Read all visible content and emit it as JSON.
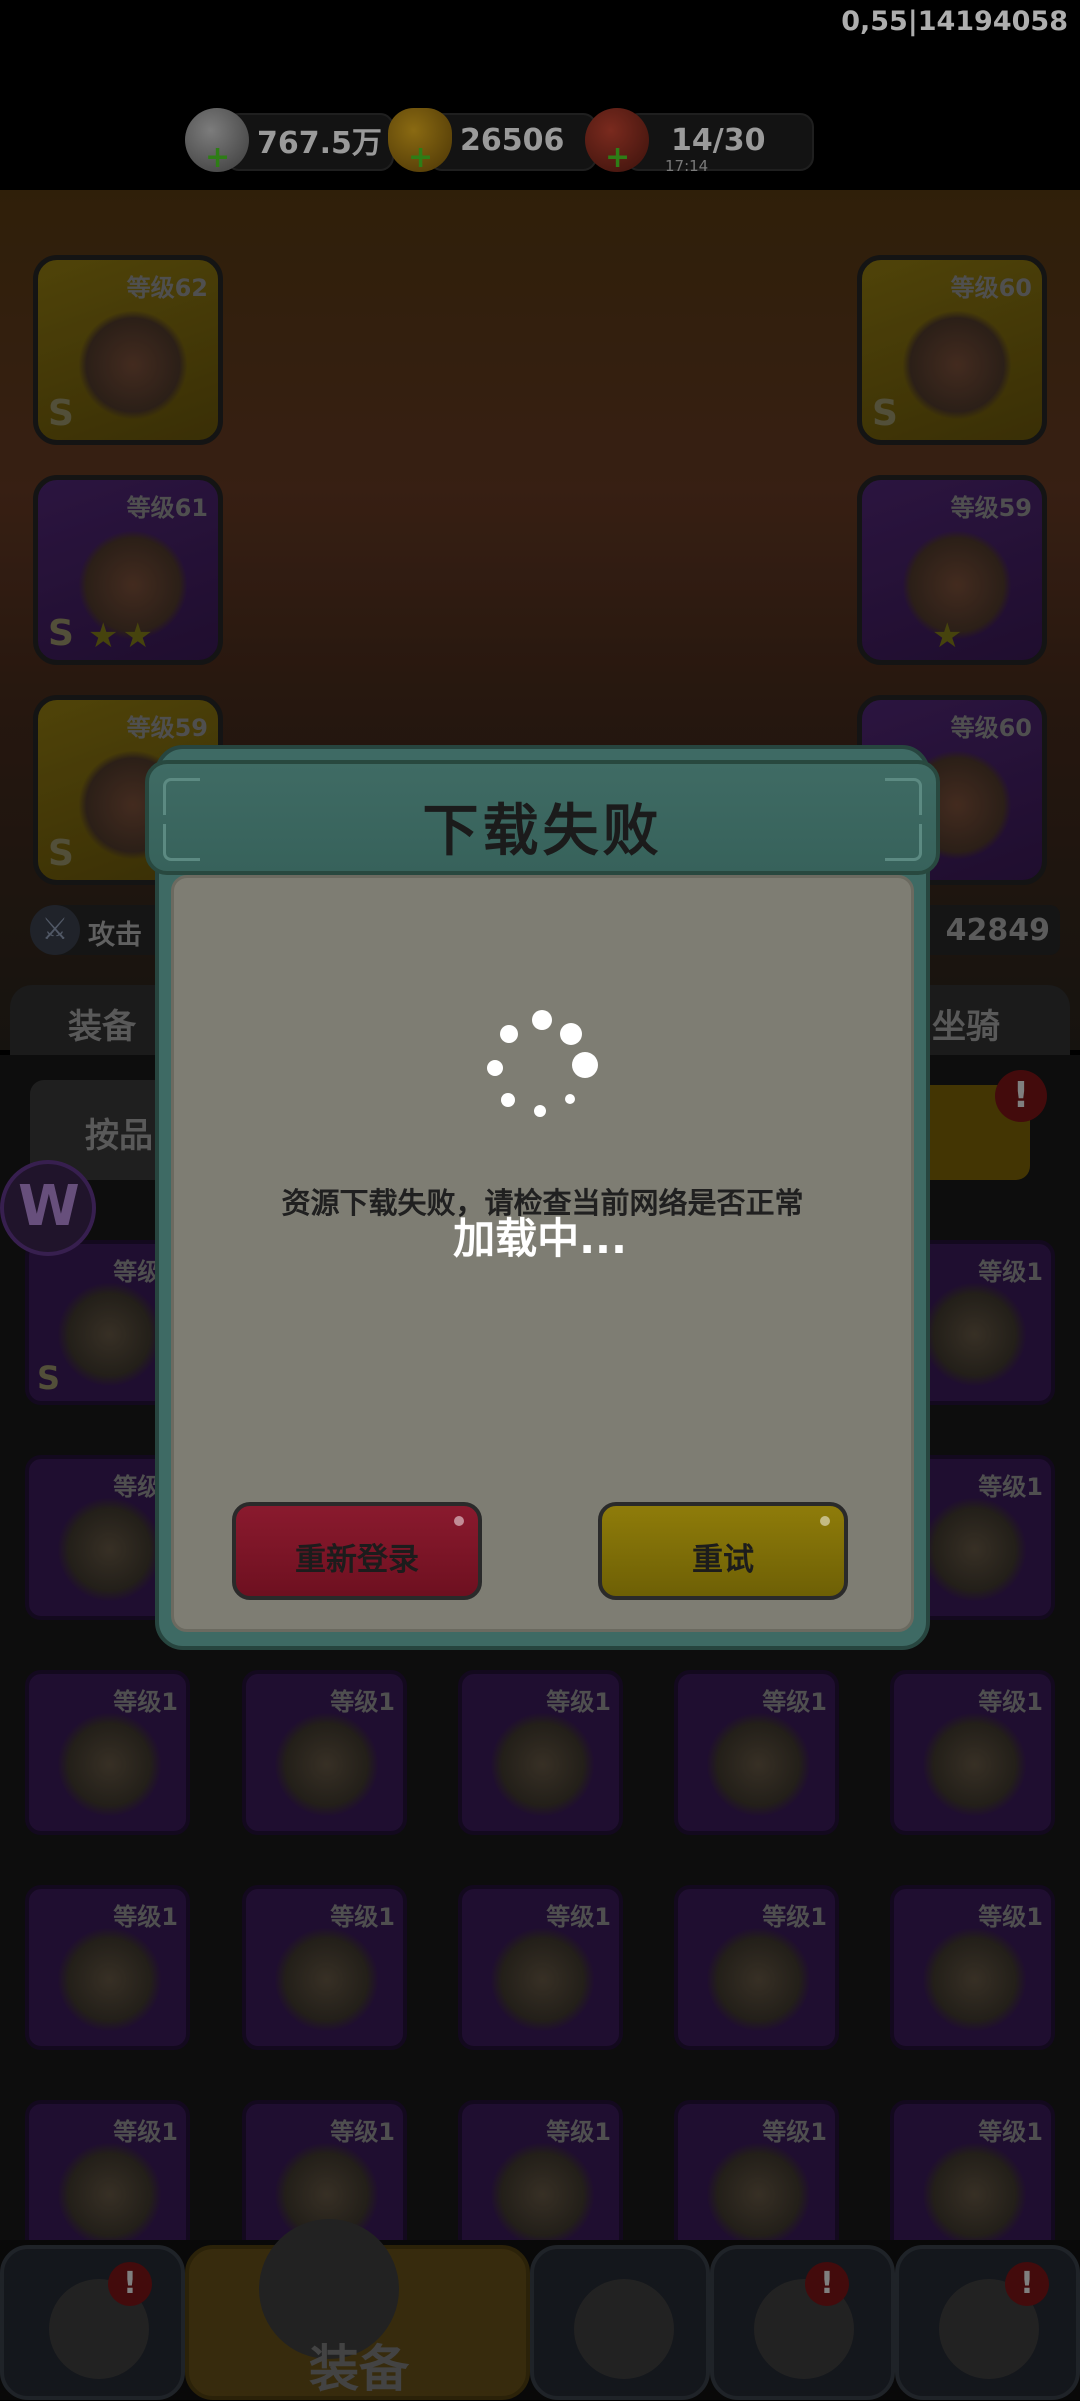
{
  "status": {
    "version": "0,55|14194058"
  },
  "resources": {
    "gems": "767.5万",
    "gold": "26506",
    "stamina": "14/30",
    "stamina_timer": "17:14",
    "gem_icon": "gem-icon",
    "gold_icon": "gold-heart-icon",
    "stamina_icon": "meat-icon"
  },
  "equipped_slots": [
    {
      "level": "等级62",
      "rarity": "S",
      "stars": ""
    },
    {
      "level": "等级60",
      "rarity": "S",
      "stars": ""
    },
    {
      "level": "等级61",
      "rarity": "S",
      "stars": "★★"
    },
    {
      "level": "等级59",
      "rarity": "",
      "stars": "★"
    },
    {
      "level": "等级59",
      "rarity": "S",
      "stars": ""
    },
    {
      "level": "等级60",
      "rarity": "",
      "stars": ""
    }
  ],
  "stats": {
    "attack_label": "攻击",
    "power_value": "42849"
  },
  "tabs": {
    "left": "装备",
    "right": "坐骑"
  },
  "toolbar": {
    "sort_label": "按品",
    "badge": "!"
  },
  "inventory": [
    {
      "level": "等级1",
      "rarity": "S"
    },
    {
      "level": "等级1",
      "rarity": ""
    },
    {
      "level": "等级1",
      "rarity": ""
    },
    {
      "level": "等级1",
      "rarity": ""
    },
    {
      "level": "等级1",
      "rarity": ""
    },
    {
      "level": "等级1",
      "rarity": ""
    },
    {
      "level": "等级1",
      "rarity": ""
    },
    {
      "level": "等级1",
      "rarity": ""
    },
    {
      "level": "等级1",
      "rarity": ""
    },
    {
      "level": "等级1",
      "rarity": ""
    },
    {
      "level": "等级1",
      "rarity": ""
    },
    {
      "level": "等级1",
      "rarity": ""
    },
    {
      "level": "等级1",
      "rarity": ""
    },
    {
      "level": "等级1",
      "rarity": ""
    },
    {
      "level": "等级1",
      "rarity": ""
    },
    {
      "level": "等级1",
      "rarity": ""
    },
    {
      "level": "等级1",
      "rarity": ""
    },
    {
      "level": "等级1",
      "rarity": ""
    },
    {
      "level": "等级1",
      "rarity": ""
    }
  ],
  "bottom_nav": {
    "active_label": "装备"
  },
  "dialog": {
    "title": "下载失败",
    "message": "资源下载失败，请检查当前网络是否正常",
    "relogin_label": "重新登录",
    "retry_label": "重试"
  },
  "loading": {
    "text": "加载中..."
  },
  "colors": {
    "dialog_frame": "#3e6a64",
    "dialog_body": "#7e7d73",
    "relogin_button": "#8a1a2e",
    "retry_button": "#8f7c0a"
  }
}
